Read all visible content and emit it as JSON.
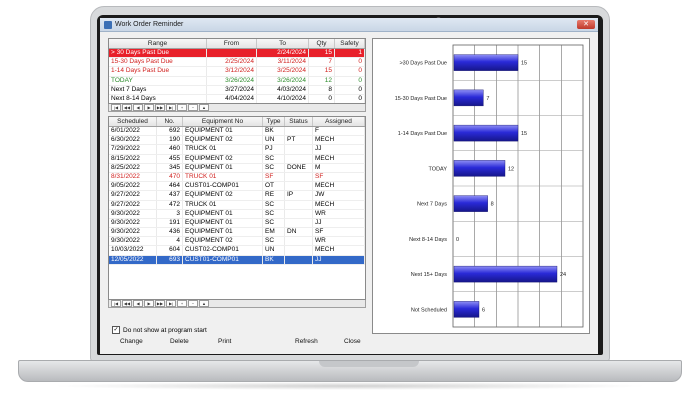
{
  "window": {
    "title": "Work Order Reminder",
    "close_glyph": "✕"
  },
  "range_table": {
    "columns": [
      "Range",
      "From",
      "To",
      "Qty",
      "Safety"
    ],
    "rows": [
      {
        "range": "> 30 Days Past Due",
        "from": "",
        "to": "2/24/2024",
        "qty": "15",
        "safety": "1",
        "style": "row-red"
      },
      {
        "range": "15-30 Days Past Due",
        "from": "2/25/2024",
        "to": "3/11/2024",
        "qty": "7",
        "safety": "0",
        "style": "txt-red"
      },
      {
        "range": "1-14 Days Past Due",
        "from": "3/12/2024",
        "to": "3/25/2024",
        "qty": "15",
        "safety": "0",
        "style": "txt-red"
      },
      {
        "range": "TODAY",
        "from": "3/26/2024",
        "to": "3/26/2024",
        "qty": "12",
        "safety": "0",
        "style": "txt-green"
      },
      {
        "range": "Next 7 Days",
        "from": "3/27/2024",
        "to": "4/03/2024",
        "qty": "8",
        "safety": "0",
        "style": ""
      },
      {
        "range": "Next 8-14 Days",
        "from": "4/04/2024",
        "to": "4/10/2024",
        "qty": "0",
        "safety": "0",
        "style": ""
      },
      {
        "range": "Next 15+ Days",
        "from": "4/11/2024",
        "to": "12/31/9999",
        "qty": "24",
        "safety": "0",
        "style": ""
      },
      {
        "range": "Not Scheduled",
        "from": "",
        "to": "",
        "qty": "",
        "safety": "",
        "style": ""
      }
    ]
  },
  "work_orders": {
    "columns": [
      "Scheduled",
      "No.",
      "Equipment No",
      "Type",
      "Status",
      "Assigned"
    ],
    "rows": [
      {
        "scheduled": "6/01/2022",
        "no": "692",
        "equipment": "EQUIPMENT 01",
        "type": "BK",
        "status": "",
        "assigned": "F",
        "style": ""
      },
      {
        "scheduled": "6/30/2022",
        "no": "190",
        "equipment": "EQUIPMENT 02",
        "type": "UN",
        "status": "PT",
        "assigned": "MECH",
        "style": ""
      },
      {
        "scheduled": "7/29/2022",
        "no": "460",
        "equipment": "TRUCK 01",
        "type": "PJ",
        "status": "",
        "assigned": "JJ",
        "style": ""
      },
      {
        "scheduled": "8/15/2022",
        "no": "455",
        "equipment": "EQUIPMENT 02",
        "type": "SC",
        "status": "",
        "assigned": "MECH",
        "style": ""
      },
      {
        "scheduled": "8/25/2022",
        "no": "345",
        "equipment": "EQUIPMENT 01",
        "type": "SC",
        "status": "DONE",
        "assigned": "M",
        "style": ""
      },
      {
        "scheduled": "8/31/2022",
        "no": "470",
        "equipment": "TRUCK 01",
        "type": "SF",
        "status": "",
        "assigned": "SF",
        "style": "txt-red"
      },
      {
        "scheduled": "9/05/2022",
        "no": "464",
        "equipment": "CUST01-COMP01",
        "type": "OT",
        "status": "",
        "assigned": "MECH",
        "style": ""
      },
      {
        "scheduled": "9/27/2022",
        "no": "437",
        "equipment": "EQUIPMENT 02",
        "type": "RE",
        "status": "IP",
        "assigned": "JW",
        "style": ""
      },
      {
        "scheduled": "9/27/2022",
        "no": "472",
        "equipment": "TRUCK 01",
        "type": "SC",
        "status": "",
        "assigned": "MECH",
        "style": ""
      },
      {
        "scheduled": "9/30/2022",
        "no": "3",
        "equipment": "EQUIPMENT 01",
        "type": "SC",
        "status": "",
        "assigned": "WR",
        "style": ""
      },
      {
        "scheduled": "9/30/2022",
        "no": "191",
        "equipment": "EQUIPMENT 01",
        "type": "SC",
        "status": "",
        "assigned": "JJ",
        "style": ""
      },
      {
        "scheduled": "9/30/2022",
        "no": "436",
        "equipment": "EQUIPMENT 01",
        "type": "EM",
        "status": "DN",
        "assigned": "SF",
        "style": ""
      },
      {
        "scheduled": "9/30/2022",
        "no": "4",
        "equipment": "EQUIPMENT 02",
        "type": "SC",
        "status": "",
        "assigned": "WR",
        "style": ""
      },
      {
        "scheduled": "10/03/2022",
        "no": "604",
        "equipment": "CUST02-COMP01",
        "type": "UN",
        "status": "",
        "assigned": "MECH",
        "style": ""
      },
      {
        "scheduled": "12/05/2022",
        "no": "693",
        "equipment": "CUST01-COMP01",
        "type": "BK",
        "status": "",
        "assigned": "JJ",
        "style": "row-sel"
      }
    ]
  },
  "nav_glyphs": [
    "|◀",
    "◀◀",
    "◀",
    "▶",
    "▶▶",
    "▶|",
    "+",
    "−",
    "▲"
  ],
  "checkbox": {
    "label": "Do not show at program start",
    "checked": true,
    "check_glyph": "✓"
  },
  "buttons": {
    "change": "Change",
    "delete": "Delete",
    "print": "Print",
    "refresh": "Refresh",
    "close": "Close"
  },
  "chart_data": {
    "type": "bar",
    "orientation": "horizontal",
    "categories": [
      ">30 Days Past Due",
      "15-30 Days Past Due",
      "1-14 Days Past Due",
      "TODAY",
      "Next 7 Days",
      "Next 8-14 Days",
      "Next 15+ Days",
      "Not Scheduled"
    ],
    "values": [
      15,
      7,
      15,
      12,
      8,
      0,
      24,
      6
    ],
    "xlim": [
      0,
      30
    ],
    "grid": true,
    "bar_color": "#2a2ad8",
    "bar_highlight": "#8f8ff5"
  },
  "colors": {
    "red_row": "#e8202a",
    "selected_row": "#3369c8",
    "green_text": "#2a8a2a",
    "red_text": "#d0201e"
  }
}
